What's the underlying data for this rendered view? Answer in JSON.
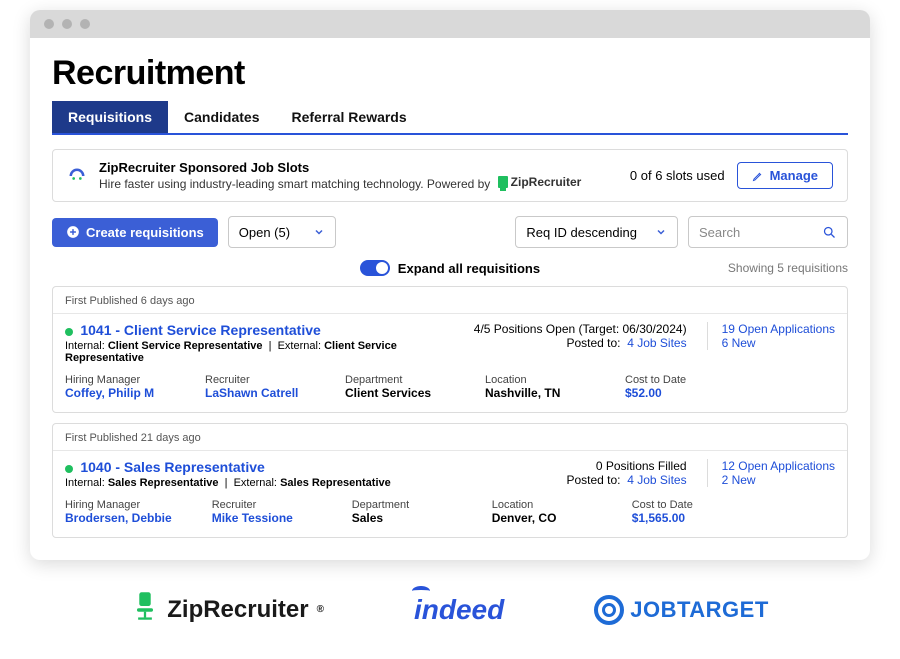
{
  "page_title": "Recruitment",
  "tabs": [
    "Requisitions",
    "Candidates",
    "Referral Rewards"
  ],
  "promo": {
    "title": "ZipRecruiter Sponsored Job Slots",
    "subtitle": "Hire faster using industry-leading smart matching technology. Powered by",
    "powered_by": "ZipRecruiter",
    "slots_used": "0 of 6 slots used",
    "manage_label": "Manage"
  },
  "controls": {
    "create_label": "Create requisitions",
    "filter_status": "Open (5)",
    "sort": "Req ID descending",
    "search_placeholder": "Search"
  },
  "expand": {
    "label": "Expand all requisitions",
    "showing": "Showing 5 requisitions"
  },
  "detail_labels": {
    "hiring_manager": "Hiring Manager",
    "recruiter": "Recruiter",
    "department": "Department",
    "location": "Location",
    "cost_to_date": "Cost to Date"
  },
  "requisitions": [
    {
      "published": "First Published 6 days ago",
      "id_title": "1041 - Client Service Representative",
      "internal_label": "Internal:",
      "internal": "Client Service Representative",
      "external_label": "External:",
      "external": "Client Service Representative",
      "positions": "4/5 Positions Open (Target: 06/30/2024)",
      "posted_label": "Posted to:",
      "posted_to": "4 Job Sites",
      "open_apps": "19 Open Applications",
      "new_apps": "6 New",
      "hiring_manager": "Coffey, Philip M",
      "recruiter": "LaShawn Catrell",
      "department": "Client Services",
      "location": "Nashville, TN",
      "cost": "$52.00"
    },
    {
      "published": "First Published 21 days ago",
      "id_title": "1040 - Sales Representative",
      "internal_label": "Internal:",
      "internal": "Sales Representative",
      "external_label": "External:",
      "external": "Sales Representative",
      "positions": "0 Positions Filled",
      "posted_label": "Posted to:",
      "posted_to": "4 Job Sites",
      "open_apps": "12 Open Applications",
      "new_apps": "2 New",
      "hiring_manager": "Brodersen, Debbie",
      "recruiter": "Mike Tessione",
      "department": "Sales",
      "location": "Denver, CO",
      "cost": "$1,565.00"
    }
  ],
  "footer_logos": {
    "zr": "ZipRecruiter",
    "indeed": "indeed",
    "jobtarget": "JOBTARGET"
  }
}
